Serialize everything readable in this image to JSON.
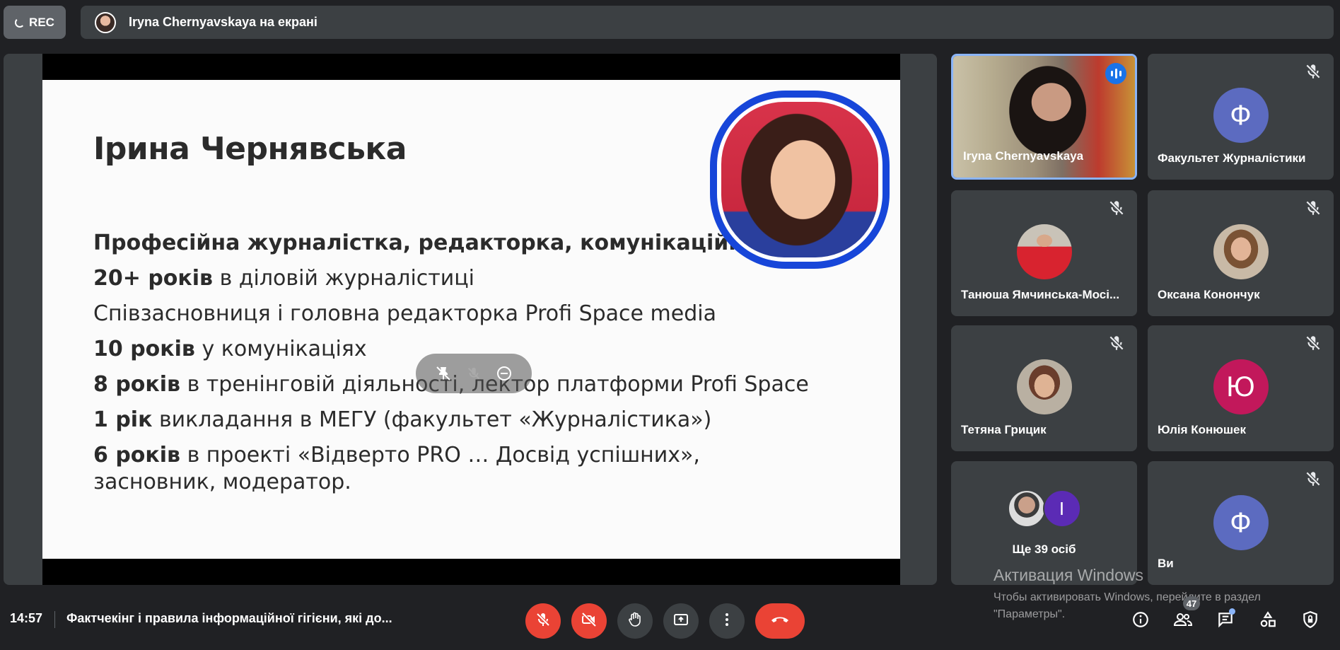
{
  "top": {
    "rec_label": "REC",
    "presenting_label": "Iryna Chernyavskaya на екрані"
  },
  "slide": {
    "title": "Ірина Чернявська",
    "lines": [
      {
        "bold": "Професійна журналістка, редакторка, комунікаційниця",
        "rest": ""
      },
      {
        "bold": "20+ років",
        "rest": " в діловій журналістиці"
      },
      {
        "bold": "",
        "rest": "Співзасновниця і головна редакторка Profi Space media"
      },
      {
        "bold": "10 років",
        "rest": " у комунікаціях"
      },
      {
        "bold": "8 років",
        "rest": " в тренінговій діяльності, лектор платформи Profi Space"
      },
      {
        "bold": "1 рік",
        "rest": " викладання в МЕГУ (факультет «Журналістика»)"
      },
      {
        "bold": "6 років",
        "rest": " в проекті «Відверто PRO … Досвід успішних», засновник, модератор."
      }
    ]
  },
  "participants": [
    {
      "name": "Iryna Chernyavskaya",
      "type": "video",
      "speaking": true
    },
    {
      "name": "Факультет Журналістики",
      "type": "letter",
      "letter": "Ф",
      "color": "#5c6bc0"
    },
    {
      "name": "Танюша Ямчинська-Мосі...",
      "type": "photo"
    },
    {
      "name": "Оксана Конончук",
      "type": "photo"
    },
    {
      "name": "Тетяна Грицик",
      "type": "photo"
    },
    {
      "name": "Юлія Конюшек",
      "type": "letter",
      "letter": "Ю",
      "color": "#c2185b"
    },
    {
      "name": "Ще 39 осіб",
      "type": "more",
      "letter": "I",
      "color": "#5b2bb5"
    },
    {
      "name": "Ви",
      "type": "letter",
      "letter": "Ф",
      "color": "#5c6bc0"
    }
  ],
  "watermark": {
    "title": "Активация Windows",
    "text": "Чтобы активировать Windows, перейдите в раздел \"Параметры\"."
  },
  "bottom": {
    "time": "14:57",
    "meeting_title": "Фактчекінг і правила інформаційної гігієни, які до...",
    "people_count": "47"
  },
  "icons": {
    "mic": "mic-off-icon",
    "cam": "camera-off-icon",
    "hand": "raise-hand-icon",
    "present": "present-icon",
    "more": "more-vert-icon",
    "hangup": "call-end-icon",
    "info": "info-icon",
    "people": "people-icon",
    "chat": "chat-icon",
    "activities": "activities-icon",
    "host": "host-controls-icon"
  },
  "colors": {
    "bg": "#202124",
    "tile": "#3c4043",
    "danger": "#ea4335",
    "accent": "#1a73e8"
  }
}
